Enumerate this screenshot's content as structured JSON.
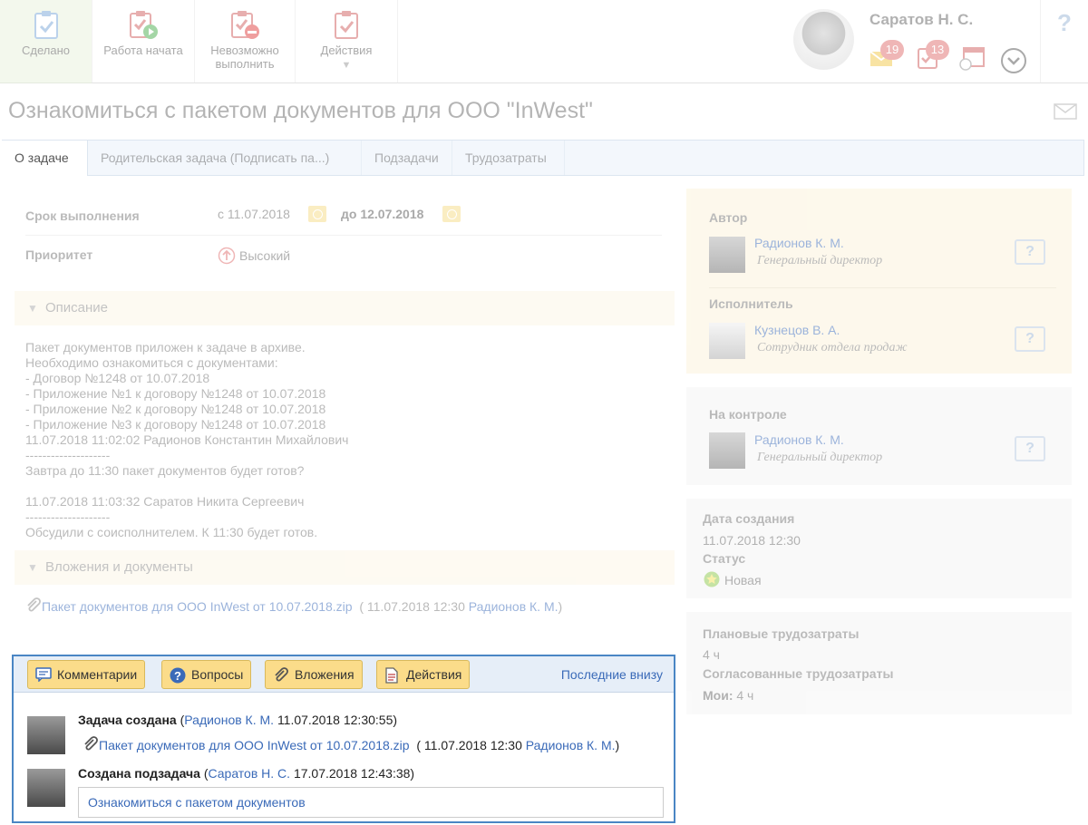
{
  "toolbar": {
    "done": "Сделано",
    "started": "Работа начата",
    "impossible": "Невозможно выполнить",
    "actions": "Действия"
  },
  "user": {
    "name": "Саратов Н. С.",
    "mail_count": "19",
    "task_count": "13"
  },
  "help": "?",
  "title": "Ознакомиться с пакетом документов для ООО \"InWest\"",
  "tabs": [
    "О задаче",
    "Родительская задача (Подписать па...)",
    "Подзадачи",
    "Трудозатраты"
  ],
  "details": {
    "deadline_label": "Срок выполнения",
    "deadline_from": "с 11.07.2018",
    "deadline_to": "до 12.07.2018",
    "priority_label": "Приоритет",
    "priority_value": "Высокий"
  },
  "description": {
    "header": "Описание",
    "text": "Пакет документов приложен к задаче в архиве.\nНеобходимо ознакомиться с документами:\n- Договор №1248 от 10.07.2018\n- Приложение №1 к договору №1248 от 10.07.2018\n- Приложение №2 к договору №1248 от 10.07.2018\n- Приложение №3 к договору №1248 от 10.07.2018\n11.07.2018 11:02:02 Радионов Константин Михайлович\n--------------------\nЗавтра до 11:30 пакет документов будет готов?\n\n11.07.2018 11:03:32 Саратов Никита Сергеевич\n--------------------\nОбсудили с соисполнителем. К 11:30 будет готов."
  },
  "attachments": {
    "header": "Вложения и документы",
    "file": "Пакет документов для ООО InWest от 10.07.2018.zip",
    "meta_open": "( 11.07.2018 12:30",
    "author": "Радионов К. М.",
    "meta_close": ")"
  },
  "people": {
    "author_label": "Автор",
    "author_name": "Радионов К. М.",
    "author_job": "Генеральный директор",
    "executor_label": "Исполнитель",
    "executor_name": "Кузнецов В. А.",
    "executor_job": "Сотрудник отдела продаж",
    "control_label": "На контроле",
    "control_name": "Радионов К. М.",
    "control_job": "Генеральный директор"
  },
  "info": {
    "created_label": "Дата создания",
    "created_value": "11.07.2018 12:30",
    "status_label": "Статус",
    "status_value": "Новая"
  },
  "effort": {
    "planned_label": "Плановые трудозатраты",
    "planned_value": "4 ч",
    "agreed_label": "Согласованные трудозатраты",
    "mine_label": "Мои:",
    "mine_value": "4 ч"
  },
  "comments": {
    "btn_comments": "Комментарии",
    "btn_questions": "Вопросы",
    "btn_attachments": "Вложения",
    "btn_actions": "Действия",
    "last_bottom": "Последние внизу",
    "e1_title": "Задача создана",
    "e1_open": "(",
    "e1_author": "Радионов К. М.",
    "e1_time": "11.07.2018 12:30:55)",
    "e1_file": "Пакет документов для ООО InWest от 10.07.2018.zip",
    "e1_meta": "( 11.07.2018 12:30",
    "e1_meta_author": "Радионов К. М.",
    "e1_meta_close": ")",
    "e2_title": "Создана подзадача",
    "e2_open": "(",
    "e2_author": "Саратов Н. С.",
    "e2_time": "17.07.2018 12:43:38)",
    "e2_subtask": "Ознакомиться с пакетом документов"
  }
}
